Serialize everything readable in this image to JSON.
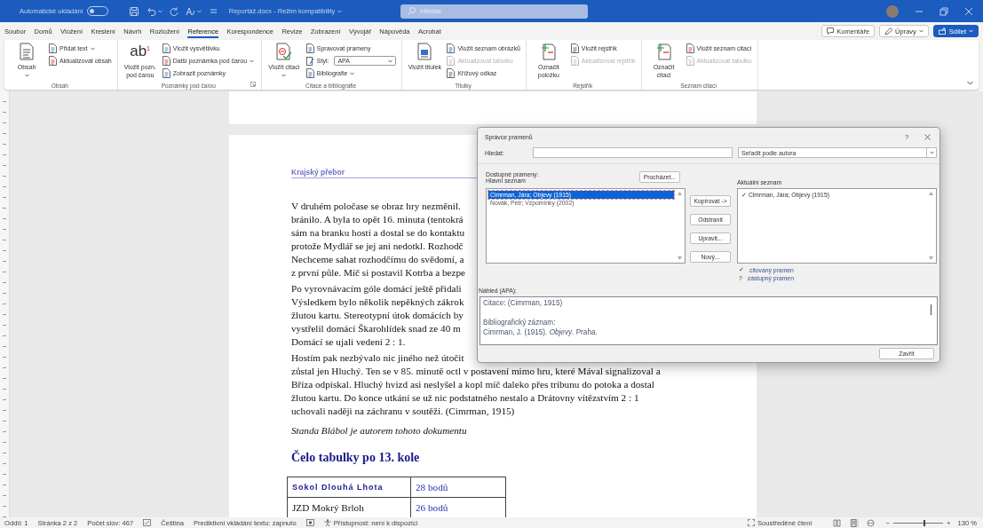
{
  "title_bar": {
    "autosave_label": "Automatické ukládání",
    "autosave_on": false,
    "document_title": "Reportáž.docx  -  Režim kompatibility",
    "search_placeholder": "Hledat"
  },
  "menu_tabs": [
    {
      "label": "Soubor",
      "selected": false
    },
    {
      "label": "Domů",
      "selected": false
    },
    {
      "label": "Vložení",
      "selected": false
    },
    {
      "label": "Kreslení",
      "selected": false
    },
    {
      "label": "Návrh",
      "selected": false
    },
    {
      "label": "Rozložení",
      "selected": false
    },
    {
      "label": "Reference",
      "selected": true
    },
    {
      "label": "Korespondence",
      "selected": false
    },
    {
      "label": "Revize",
      "selected": false
    },
    {
      "label": "Zobrazení",
      "selected": false
    },
    {
      "label": "Vývojář",
      "selected": false
    },
    {
      "label": "Nápověda",
      "selected": false
    },
    {
      "label": "Acrobat",
      "selected": false
    }
  ],
  "header_buttons": [
    {
      "kind": "comments",
      "label": "Komentáře"
    },
    {
      "kind": "editing",
      "label": "Úpravy"
    },
    {
      "kind": "share",
      "label": "Sdílet"
    }
  ],
  "ribbon_groups": [
    {
      "label": "Obsah",
      "launcher": false,
      "large": {
        "label": "Obsah",
        "dropdown": true
      },
      "items": [
        {
          "kind": "button",
          "label": "Přidat text",
          "dropdown": true,
          "disabled": false
        },
        {
          "kind": "button",
          "label": "Aktualizovat obsah",
          "dropdown": false,
          "disabled": false
        }
      ]
    },
    {
      "label": "Poznámky pod čarou",
      "launcher": true,
      "large": {
        "label": "Vložit pozn. pod čarou",
        "glyph": "ab",
        "glyph_mark": "1",
        "dropdown": false
      },
      "items": [
        {
          "kind": "button",
          "label": "Vložit vysvětlivku",
          "dropdown": false,
          "disabled": false
        },
        {
          "kind": "button",
          "label": "Další poznámka pod čarou",
          "dropdown": true,
          "disabled": false
        },
        {
          "kind": "button",
          "label": "Zobrazit poznámky",
          "dropdown": false,
          "disabled": false
        }
      ]
    },
    {
      "label": "Citace a bibliografie",
      "launcher": false,
      "large": {
        "label": "Vložit citaci",
        "dropdown": true
      },
      "items": [
        {
          "kind": "button",
          "label": "Spravovat prameny",
          "dropdown": false,
          "disabled": false
        },
        {
          "kind": "select",
          "label": "Styl:",
          "value": "APA"
        },
        {
          "kind": "button",
          "label": "Bibliografie",
          "dropdown": true,
          "disabled": false
        }
      ]
    },
    {
      "label": "Titulky",
      "launcher": false,
      "large": {
        "label": "Vložit titulek",
        "dropdown": false
      },
      "items": [
        {
          "kind": "button",
          "label": "Vložit seznam obrázků",
          "dropdown": false,
          "disabled": false
        },
        {
          "kind": "button",
          "label": "Aktualizovat tabulku",
          "dropdown": false,
          "disabled": true
        },
        {
          "kind": "button",
          "label": "Křížový odkaz",
          "dropdown": false,
          "disabled": false
        }
      ]
    },
    {
      "label": "Rejstřík",
      "launcher": false,
      "large": {
        "label": "Označit položku",
        "dropdown": false
      },
      "items": [
        {
          "kind": "button",
          "label": "Vložit rejstřík",
          "dropdown": false,
          "disabled": false
        },
        {
          "kind": "button",
          "label": "Aktualizovat rejstřík",
          "dropdown": false,
          "disabled": true
        }
      ]
    },
    {
      "label": "Seznam citací",
      "launcher": false,
      "large": {
        "label": "Označit citaci",
        "dropdown": false
      },
      "items": [
        {
          "kind": "button",
          "label": "Vložit seznam citací",
          "dropdown": false,
          "disabled": false
        },
        {
          "kind": "button",
          "label": "Aktualizovat tabulku",
          "dropdown": false,
          "disabled": true
        }
      ]
    }
  ],
  "document": {
    "header": "Krajský přebor",
    "paragraphs": [
      [
        "V druhém poločase se obraz hry nezměnil.",
        "bránilo. A byla to opět 16. minuta (tentokrá",
        "sám na branku hostí a dostal se do kontaktu",
        "protože Mydlář se jej ani nedotkl. Rozhodč",
        "Nechceme sahat rozhodčímu do svědomí, a",
        "z první půle. Míč si postavil Kotrba a bezpe"
      ],
      [
        "Po vyrovnávacím góle domácí ještě přidali",
        "Výsledkem bylo několik nepěkných zákrok",
        "žlutou kartu. Stereotypní útok domácích by",
        "vystřelil domácí Škarohlídek snad ze 40 m",
        "Domácí se ujali vedení 2 : 1."
      ],
      [
        "Hostím pak nezbývalo nic jiného než útočit",
        "zůstal jen Hluchý. Ten se v 85. minutě octl v postavení mimo hru, které Mával signalizoval a",
        "Bříza odpískal. Hluchý hvizd asi neslyšel a kopl míč daleko přes tribunu do potoka a dostal",
        "žlutou kartu. Do konce utkání se už nic podstatného nestalo a Drátovny vítězstvím 2 : 1",
        "uchovali naději na záchranu v soutěži. (Cimrman, 1915)"
      ]
    ],
    "signature": "Standa Blábol je autorem tohoto dokumentu",
    "heading": "Čelo tabulky po 13. kole",
    "table": [
      {
        "team": "Sokol Dlouhá Lhota",
        "points": "28 bodů",
        "kind": "leader"
      },
      {
        "team": "JZD Mokrý Brloh",
        "points": "26 bodů",
        "kind": "plain"
      }
    ]
  },
  "dialog": {
    "title": "Správce pramenů",
    "help": "?",
    "search_label": "Hledat:",
    "sort_value": "Seřadit podle autora",
    "available_label": "Dostupné prameny:",
    "browse_button": "Procházet...",
    "master_label": "Hlavní seznam",
    "master_list": [
      {
        "label": "Cimrman, Jára; Objevy (1915)",
        "selected": true
      },
      {
        "label": "Novák, Petr; Vzpomínky (2002)",
        "selected": false
      }
    ],
    "actions": [
      "Kopírovat ->",
      "Odstranit",
      "Upravit...",
      "Nový..."
    ],
    "current_label": "Aktuální seznam",
    "current_list": [
      {
        "mark": "✓",
        "label": "Cimrman, Jára; Objevy (1915)"
      }
    ],
    "legend": [
      {
        "mark": "✓",
        "label": "citovaný pramen"
      },
      {
        "mark": "?",
        "label": "zástupný pramen"
      }
    ],
    "preview_label": "Náhled (APA):",
    "citation": "Citace:  (Cimrman, 1915)",
    "bibliography_label": "Bibliografický záznam:",
    "bibliography": "Cimrman, J. (1915). *Objevy*. Praha.",
    "close_button": "Zavřít"
  },
  "status_bar": {
    "items": [
      {
        "kind": "text",
        "label": "Oddíl: 1"
      },
      {
        "kind": "text",
        "label": "Stránka 2 z 2"
      },
      {
        "kind": "text",
        "label": "Počet slov: 467"
      },
      {
        "kind": "proofing"
      },
      {
        "kind": "text",
        "label": "Čeština"
      },
      {
        "kind": "text",
        "label": "Prediktivní vkládání textu: zapnuto"
      },
      {
        "kind": "macro"
      },
      {
        "kind": "accessibility",
        "label": "Přístupnost: není k dispozici"
      }
    ],
    "focus_label": "Soustředěné čtení",
    "views": [
      {
        "selected": false
      },
      {
        "selected": true
      },
      {
        "selected": false
      }
    ],
    "zoom_out": "−",
    "zoom_in": "+",
    "zoom": {
      "level": 0.6,
      "label": "130 %"
    }
  }
}
